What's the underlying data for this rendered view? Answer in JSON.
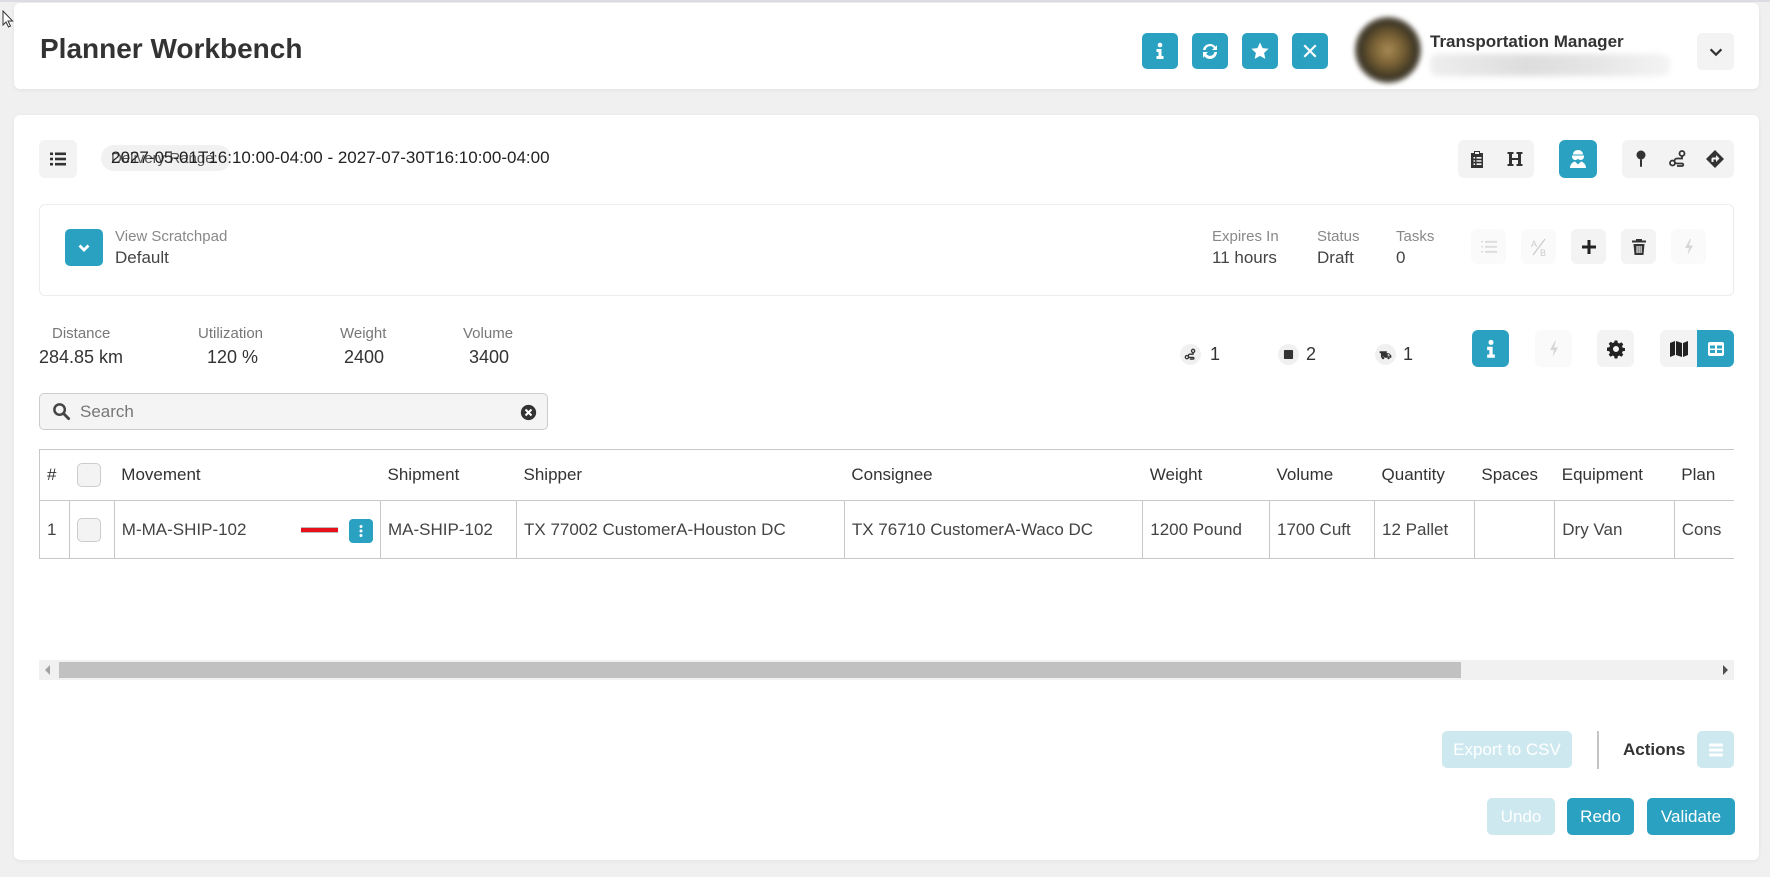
{
  "header": {
    "title": "Planner Workbench",
    "buttons": [
      {
        "name": "info",
        "icon": "info-icon"
      },
      {
        "name": "refresh",
        "icon": "refresh-icon"
      },
      {
        "name": "favorite",
        "icon": "star-icon"
      },
      {
        "name": "close",
        "icon": "close-icon"
      }
    ],
    "user": {
      "role": "Transportation Manager"
    }
  },
  "toolbar": {
    "delivery_range_label": "Delivery Range:",
    "delivery_range_value": "2027-05-01T16:10:00-04:00 - 2027-07-30T16:10:00-04:00",
    "left_icon": "list-icon",
    "right_icons": [
      "clipboard-icon",
      "heading-icon",
      "driver-icon",
      "map-pin-icon",
      "route-icon",
      "directions-icon"
    ]
  },
  "scratchpad": {
    "label": "View Scratchpad",
    "value": "Default",
    "expires_label": "Expires In",
    "expires_value": "11 hours",
    "status_label": "Status",
    "status_value": "Draft",
    "tasks_label": "Tasks",
    "tasks_value": "0",
    "actions": [
      "numbered-list-icon",
      "ab-test-icon",
      "plus-icon",
      "trash-icon",
      "bolt-icon"
    ]
  },
  "metrics": {
    "distance_label": "Distance",
    "distance_value": "284.85 km",
    "utilization_label": "Utilization",
    "utilization_value": "120 %",
    "weight_label": "Weight",
    "weight_value": "2400",
    "volume_label": "Volume",
    "volume_value": "3400",
    "counts": [
      {
        "icon": "route-icon",
        "value": "1"
      },
      {
        "icon": "stop-icon",
        "value": "2"
      },
      {
        "icon": "truck-icon",
        "value": "1"
      }
    ]
  },
  "search": {
    "placeholder": "Search",
    "value": ""
  },
  "table": {
    "columns": [
      "#",
      "",
      "Movement",
      "Shipment",
      "Shipper",
      "Consignee",
      "Weight",
      "Volume",
      "Quantity",
      "Spaces",
      "Equipment",
      "Plan"
    ],
    "rows": [
      {
        "num": "1",
        "movement": "M-MA-SHIP-102",
        "shipment": "MA-SHIP-102",
        "shipper": "TX 77002 CustomerA-Houston DC",
        "consignee": "TX 76710 CustomerA-Waco DC",
        "weight": "1200 Pound",
        "volume": "1700 Cuft",
        "quantity": "12 Pallet",
        "spaces": "",
        "equipment": "Dry Van",
        "plan": "Cons"
      }
    ]
  },
  "scroll": {
    "horizontal_position_percent": 0,
    "visible_fraction": 0.84
  },
  "footer": {
    "export_label": "Export to CSV",
    "actions_label": "Actions",
    "undo_label": "Undo",
    "redo_label": "Redo",
    "validate_label": "Validate"
  },
  "colors": {
    "accent": "#2ba1c1",
    "accent_disabled": "#cde8ef",
    "error_marker": "#e8111b"
  }
}
